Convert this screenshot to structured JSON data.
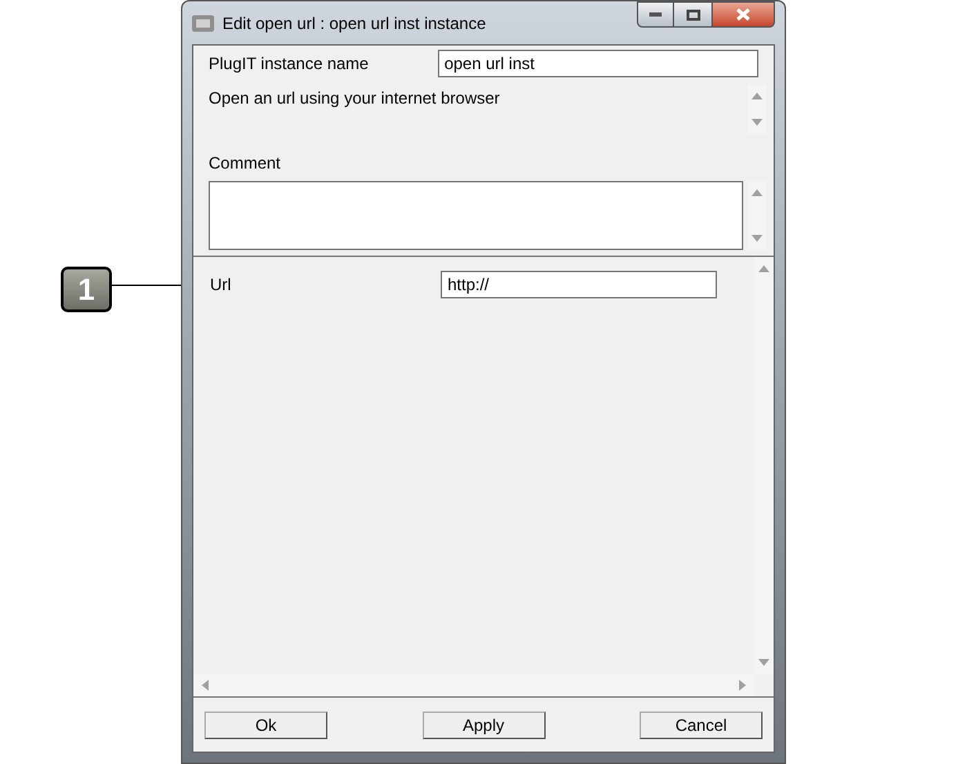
{
  "window": {
    "title": "Edit open url : open url inst instance"
  },
  "instance": {
    "label": "PlugIT instance name",
    "value": "open url inst"
  },
  "description": "Open an url using your internet browser",
  "comment": {
    "label": "Comment"
  },
  "parameters": [
    {
      "label": "Url",
      "value": "http://"
    }
  ],
  "callout": {
    "number": "1"
  },
  "buttons": [
    "Ok",
    "Apply",
    "Cancel"
  ]
}
